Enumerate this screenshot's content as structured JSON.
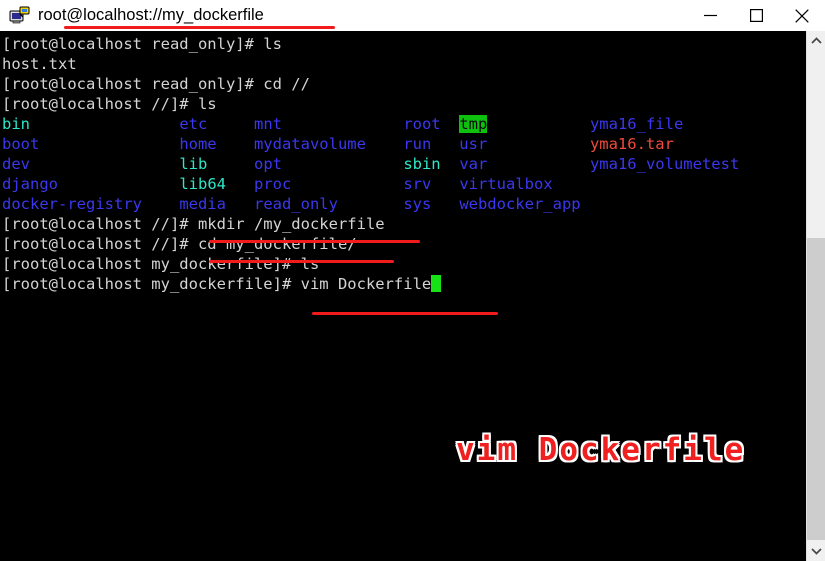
{
  "window": {
    "title": "root@localhost://my_dockerfile",
    "icon": "putty-terminal-icon",
    "controls": {
      "minimize_label": "Minimize",
      "maximize_label": "Maximize",
      "close_label": "Close"
    }
  },
  "terminal": {
    "prompt_read_only": "[root@localhost read_only]# ",
    "prompt_root": "[root@localhost //]# ",
    "prompt_dockerfile": "[root@localhost my_dockerfile]# ",
    "lines": [
      {
        "id": "line-1",
        "segments": [
          {
            "text": "[root@localhost read_only]# ls",
            "style": "default"
          }
        ]
      },
      {
        "id": "line-2",
        "segments": [
          {
            "text": "host.txt",
            "style": "default"
          }
        ]
      },
      {
        "id": "line-3",
        "segments": [
          {
            "text": "[root@localhost read_only]# cd //",
            "style": "default"
          }
        ]
      },
      {
        "id": "line-4",
        "segments": [
          {
            "text": "[root@localhost //]# ls",
            "style": "default"
          }
        ]
      },
      {
        "id": "line-5",
        "segments": [
          {
            "text": "bin",
            "style": "link"
          },
          {
            "text": "                ",
            "style": "default"
          },
          {
            "text": "etc",
            "style": "dir"
          },
          {
            "text": "     ",
            "style": "default"
          },
          {
            "text": "mnt",
            "style": "dir"
          },
          {
            "text": "             ",
            "style": "default"
          },
          {
            "text": "root",
            "style": "dir"
          },
          {
            "text": "  ",
            "style": "default"
          },
          {
            "text": "tmp",
            "style": "tmp"
          },
          {
            "text": "           ",
            "style": "default"
          },
          {
            "text": "yma16_file",
            "style": "dir"
          }
        ]
      },
      {
        "id": "line-6",
        "segments": [
          {
            "text": "boot",
            "style": "dir"
          },
          {
            "text": "               ",
            "style": "default"
          },
          {
            "text": "home",
            "style": "dir"
          },
          {
            "text": "    ",
            "style": "default"
          },
          {
            "text": "mydatavolume",
            "style": "dir"
          },
          {
            "text": "    ",
            "style": "default"
          },
          {
            "text": "run",
            "style": "dir"
          },
          {
            "text": "   ",
            "style": "default"
          },
          {
            "text": "usr",
            "style": "dir"
          },
          {
            "text": "           ",
            "style": "default"
          },
          {
            "text": "yma16.tar",
            "style": "arch"
          }
        ]
      },
      {
        "id": "line-7",
        "segments": [
          {
            "text": "dev",
            "style": "dir"
          },
          {
            "text": "                ",
            "style": "default"
          },
          {
            "text": "lib",
            "style": "link"
          },
          {
            "text": "     ",
            "style": "default"
          },
          {
            "text": "opt",
            "style": "dir"
          },
          {
            "text": "             ",
            "style": "default"
          },
          {
            "text": "sbin",
            "style": "link"
          },
          {
            "text": "  ",
            "style": "default"
          },
          {
            "text": "var",
            "style": "dir"
          },
          {
            "text": "           ",
            "style": "default"
          },
          {
            "text": "yma16_volumetest",
            "style": "dir"
          }
        ]
      },
      {
        "id": "line-8",
        "segments": [
          {
            "text": "django",
            "style": "dir"
          },
          {
            "text": "             ",
            "style": "default"
          },
          {
            "text": "lib64",
            "style": "link"
          },
          {
            "text": "   ",
            "style": "default"
          },
          {
            "text": "proc",
            "style": "dir"
          },
          {
            "text": "            ",
            "style": "default"
          },
          {
            "text": "srv",
            "style": "dir"
          },
          {
            "text": "   ",
            "style": "default"
          },
          {
            "text": "virtualbox",
            "style": "dir"
          }
        ]
      },
      {
        "id": "line-9",
        "segments": [
          {
            "text": "docker-registry",
            "style": "dir"
          },
          {
            "text": "    ",
            "style": "default"
          },
          {
            "text": "media",
            "style": "dir"
          },
          {
            "text": "   ",
            "style": "default"
          },
          {
            "text": "read_only",
            "style": "dir"
          },
          {
            "text": "       ",
            "style": "default"
          },
          {
            "text": "sys",
            "style": "dir"
          },
          {
            "text": "   ",
            "style": "default"
          },
          {
            "text": "webdocker_app",
            "style": "dir"
          }
        ]
      },
      {
        "id": "line-10",
        "segments": [
          {
            "text": "[root@localhost //]# mkdir /my_dockerfile",
            "style": "default"
          }
        ]
      },
      {
        "id": "line-11",
        "segments": [
          {
            "text": "[root@localhost //]# cd my_dockerfile/",
            "style": "default"
          }
        ]
      },
      {
        "id": "line-12",
        "segments": [
          {
            "text": "[root@localhost my_dockerfile]# ls",
            "style": "default"
          }
        ]
      },
      {
        "id": "line-13",
        "segments": [
          {
            "text": "[root@localhost my_dockerfile]# vim Dockerfile",
            "style": "default"
          }
        ],
        "cursor": true
      }
    ],
    "commands": [
      "ls",
      "cd //",
      "ls",
      "mkdir /my_dockerfile",
      "cd my_dockerfile/",
      "ls",
      "vim Dockerfile"
    ],
    "listing": {
      "column_1": [
        "bin",
        "boot",
        "dev",
        "django",
        "docker-registry"
      ],
      "column_2": [
        "etc",
        "home",
        "lib",
        "lib64",
        "media"
      ],
      "column_3": [
        "mnt",
        "mydatavolume",
        "opt",
        "proc",
        "read_only"
      ],
      "column_4": [
        "root",
        "run",
        "sbin",
        "srv",
        "sys"
      ],
      "column_5": [
        "tmp",
        "usr",
        "var",
        "virtualbox",
        "webdocker_app"
      ],
      "column_6": [
        "yma16_file",
        "yma16.tar",
        "yma16_volumetest"
      ]
    },
    "read_only_listing": [
      "host.txt"
    ],
    "cursor": "block-cursor"
  },
  "annotations": {
    "caption": "vim Dockerfile",
    "underlines": [
      {
        "name": "underline-title",
        "target": "root@localhost://my_dockerfile"
      },
      {
        "name": "underline-mkdir",
        "target": "mkdir /my_dockerfile"
      },
      {
        "name": "underline-cd",
        "target": "cd my_dockerfile/"
      },
      {
        "name": "underline-vim",
        "target": "vim Dockerfile"
      }
    ]
  },
  "colors": {
    "annotation_red": "#f21b1b",
    "caption_red": "#ef2020",
    "terminal_bg": "#000000",
    "text_default": "#d4d4d4",
    "directory_blue": "#3b37ee",
    "symlink_cyan": "#2ee6c8",
    "archive_red": "#f04a3c",
    "tmp_highlight_bg": "#0fc10f",
    "cursor_green": "#16e216"
  },
  "scrollbar": {
    "up_arrow": "chevron-up-icon",
    "down_arrow": "chevron-down-icon",
    "thumb": "scrollbar-thumb"
  }
}
